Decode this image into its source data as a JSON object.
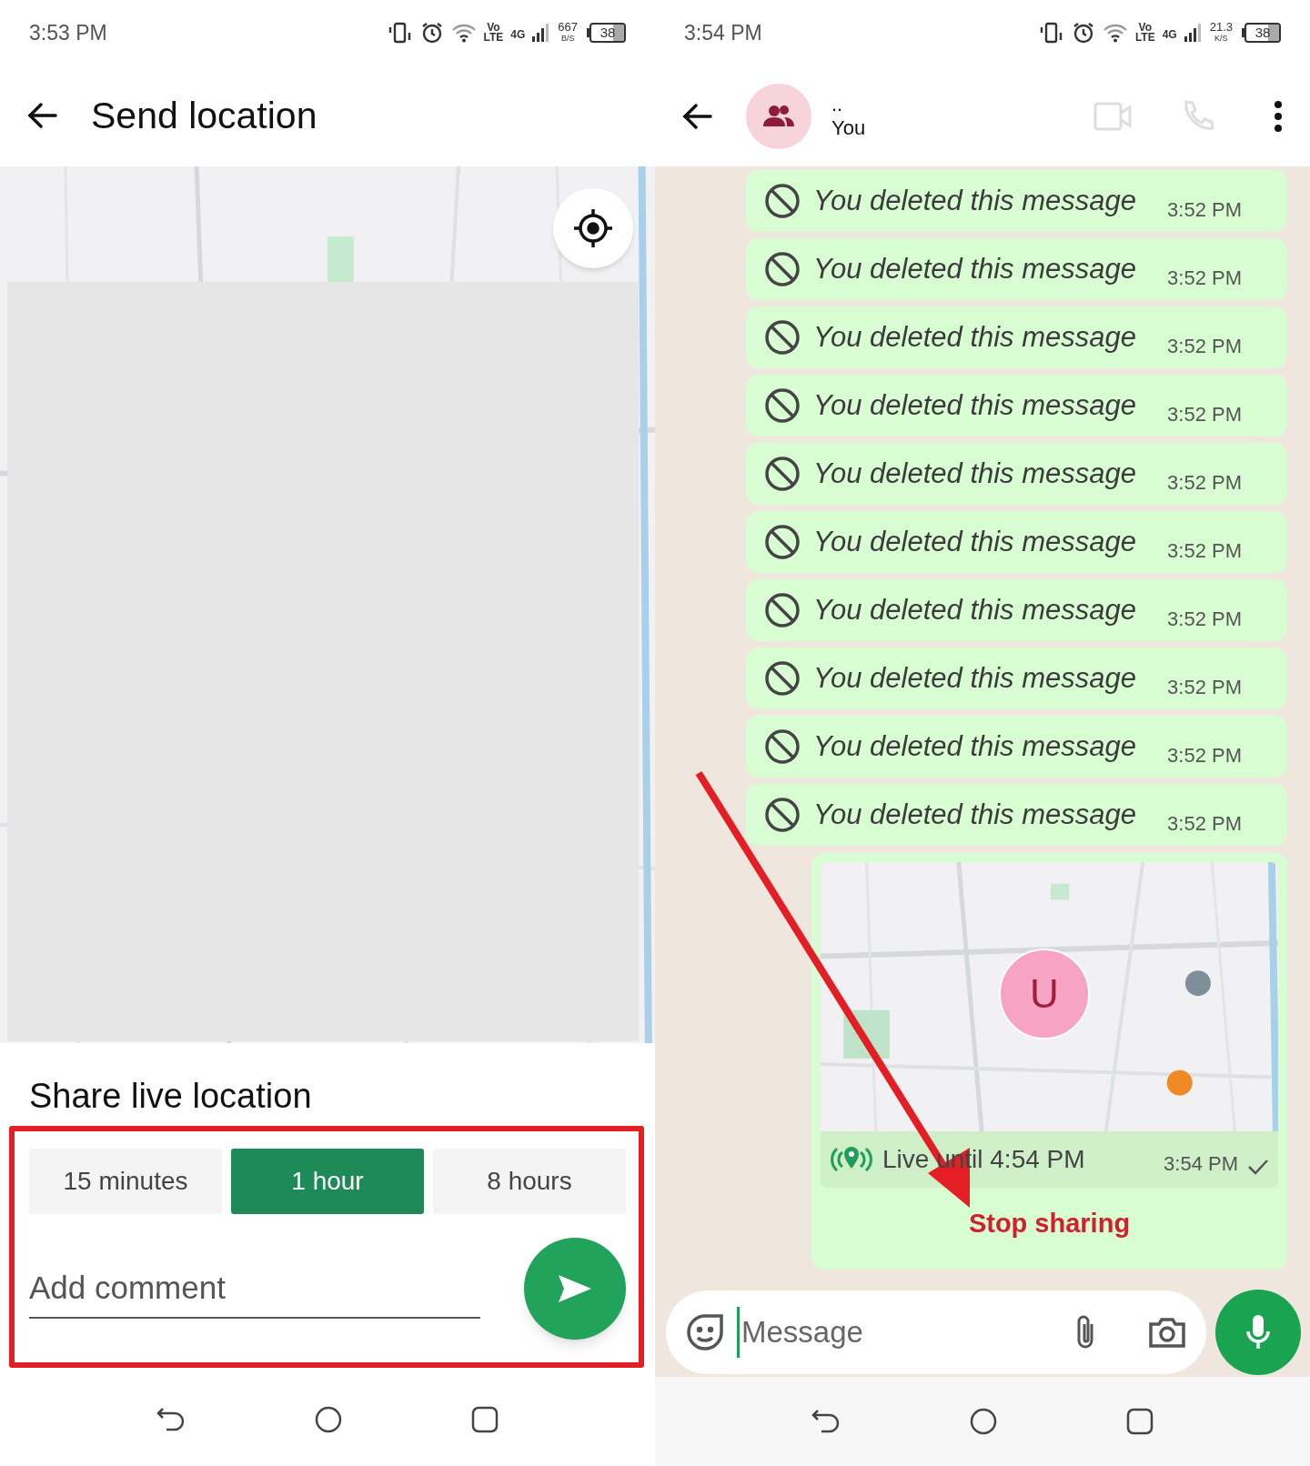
{
  "left_screen": {
    "status_bar": {
      "time": "3:53 PM",
      "volte": [
        "Vo",
        "LTE"
      ],
      "network": "4G",
      "speed": [
        "667",
        "B/S"
      ],
      "battery": "38"
    },
    "header": {
      "title": "Send location"
    },
    "share_sheet": {
      "title": "Share live location",
      "durations": [
        {
          "label": "15 minutes",
          "selected": false
        },
        {
          "label": "1 hour",
          "selected": true
        },
        {
          "label": "8 hours",
          "selected": false
        }
      ],
      "comment": {
        "placeholder": "Add comment"
      }
    }
  },
  "right_screen": {
    "status_bar": {
      "time": "3:54 PM",
      "volte": [
        "Vo",
        "LTE"
      ],
      "network": "4G",
      "speed": [
        "21.3",
        "K/S"
      ],
      "battery": "38"
    },
    "header": {
      "name": "..",
      "subtitle": "You"
    },
    "messages": [
      {
        "text": "You deleted this message",
        "time": "3:52 PM"
      },
      {
        "text": "You deleted this message",
        "time": "3:52 PM"
      },
      {
        "text": "You deleted this message",
        "time": "3:52 PM"
      },
      {
        "text": "You deleted this message",
        "time": "3:52 PM"
      },
      {
        "text": "You deleted this message",
        "time": "3:52 PM"
      },
      {
        "text": "You deleted this message",
        "time": "3:52 PM"
      },
      {
        "text": "You deleted this message",
        "time": "3:52 PM"
      },
      {
        "text": "You deleted this message",
        "time": "3:52 PM"
      },
      {
        "text": "You deleted this message",
        "time": "3:52 PM"
      },
      {
        "text": "You deleted this message",
        "time": "3:52 PM"
      }
    ],
    "live_location": {
      "avatar": "U",
      "status": "Live until 4:54 PM",
      "time": "3:54 PM",
      "action": "Stop sharing"
    },
    "composer": {
      "placeholder": "Message"
    }
  }
}
